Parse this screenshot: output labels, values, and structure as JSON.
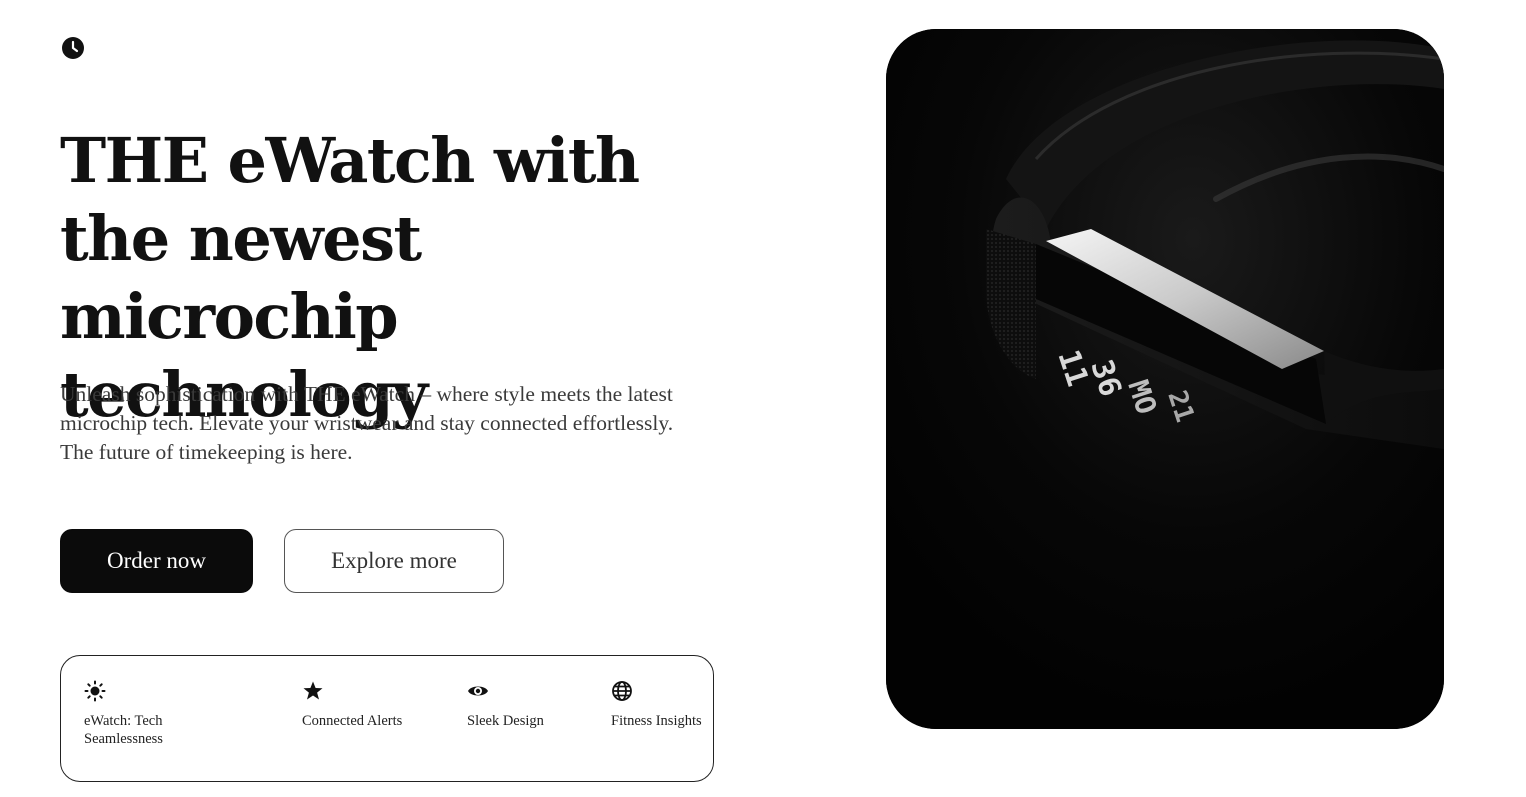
{
  "logo": {
    "icon": "clock-icon"
  },
  "hero": {
    "headline": "THE eWatch with the newest microchip technology",
    "subtitle": "Unleash sophistication with THE eWatch – where style meets the latest microchip tech. Elevate your wristwear and stay connected effortlessly. The future of timekeeping is here.",
    "primary_button": "Order now",
    "secondary_button": "Explore more"
  },
  "features": [
    {
      "icon": "sun-icon",
      "label": "eWatch: Tech Seamlessness"
    },
    {
      "icon": "star-icon",
      "label": "Connected Alerts"
    },
    {
      "icon": "eye-icon",
      "label": "Sleek Design"
    },
    {
      "icon": "globe-icon",
      "label": "Fitness Insights"
    }
  ],
  "image": {
    "description_visible_text": [
      "11",
      "36",
      "MO",
      "21"
    ]
  },
  "colors": {
    "text": "#111111",
    "muted_text": "#3a3a3a",
    "primary_button_bg": "#0b0b0b",
    "background": "#ffffff"
  }
}
